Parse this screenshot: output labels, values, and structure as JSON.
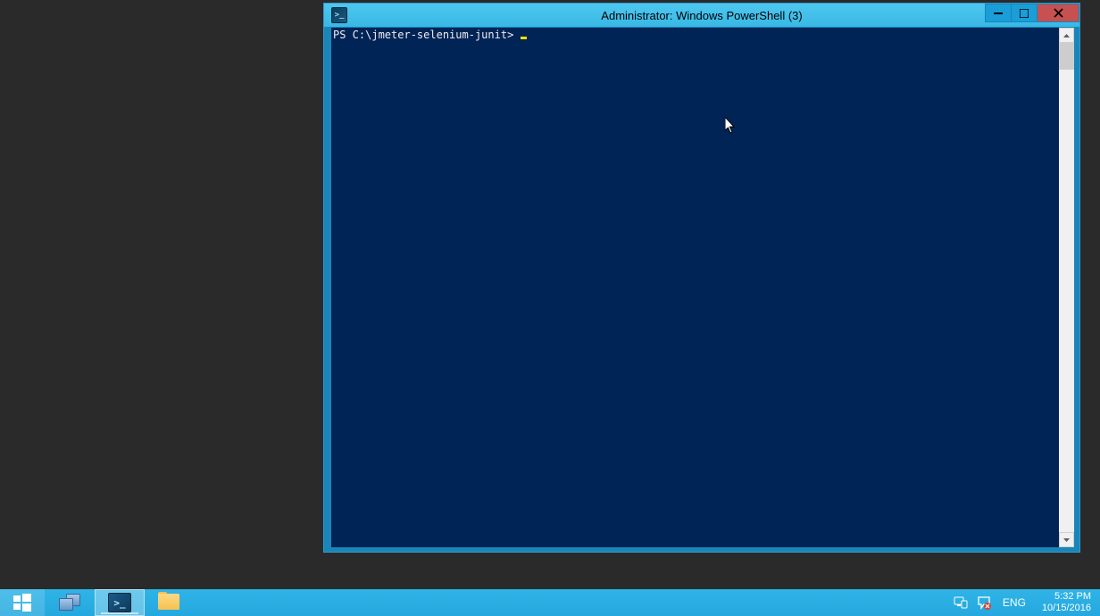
{
  "window": {
    "title": "Administrator: Windows PowerShell (3)",
    "icon_label": ">_"
  },
  "console": {
    "prompt": "PS C:\\jmeter-selenium-junit> "
  },
  "taskbar": {
    "start": "Start",
    "items": [
      {
        "name": "server-manager",
        "active": false
      },
      {
        "name": "powershell",
        "active": true,
        "label": ">_"
      },
      {
        "name": "file-explorer",
        "active": false
      }
    ],
    "lang": "ENG",
    "time": "5:32 PM",
    "date": "10/15/2016"
  }
}
